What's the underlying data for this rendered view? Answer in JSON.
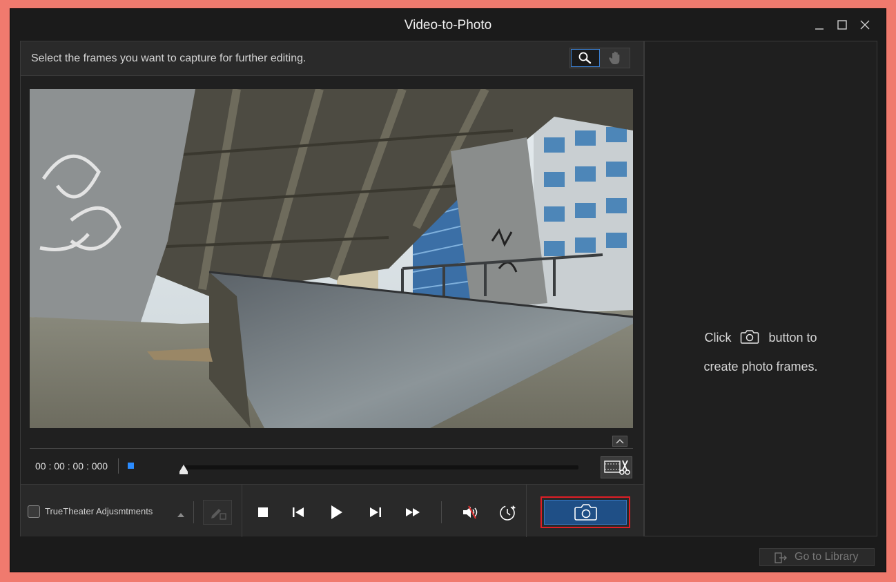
{
  "window": {
    "title": "Video-to-Photo",
    "controls": [
      "minimize-icon",
      "maximize-icon",
      "close-icon"
    ]
  },
  "main": {
    "instruction": "Select the frames you want to capture for further editing.",
    "tools": [
      {
        "name": "zoom-tool",
        "icon": "magnifier-icon",
        "active": true
      },
      {
        "name": "hand-tool",
        "icon": "hand-icon",
        "active": false
      }
    ],
    "timecode": "00 : 00 : 00 : 000",
    "playhead_position": 0
  },
  "controls": {
    "truetheater_label": "TrueTheater Adjusmtments",
    "truetheater_checked": false,
    "buttons": [
      "stop-icon",
      "previous-frame-icon",
      "play-icon",
      "next-frame-icon",
      "fast-forward-icon",
      "volume-mute-icon",
      "speed-icon"
    ],
    "capture_icon": "camera-icon"
  },
  "right_panel": {
    "hint_prefix": "Click",
    "hint_suffix": "button to",
    "hint_line2": "create photo frames."
  },
  "footer": {
    "library_label": "Go to Library"
  },
  "colors": {
    "accent": "#2b8cff",
    "capture_button": "#1f4f86",
    "highlight_border": "#e01e26",
    "frame_background": "#f07a6e"
  }
}
